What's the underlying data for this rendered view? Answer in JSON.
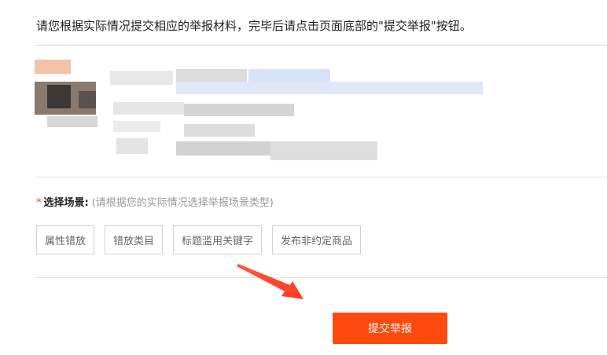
{
  "instruction": "请您根据实际情况提交相应的举报材料，完毕后请点击页面底部的\"提交举报\"按钮。",
  "scene": {
    "required_mark": "*",
    "label": "选择场景:",
    "hint": "(请根据您的实际情况选择举报场景类型)",
    "options": [
      "属性错放",
      "错放类目",
      "标题滥用关键字",
      "发布非约定商品"
    ]
  },
  "submit_label": "提交举报",
  "colors": {
    "accent": "#ff4a0f",
    "required": "#ff4400",
    "arrow": "#ff3b1f"
  }
}
